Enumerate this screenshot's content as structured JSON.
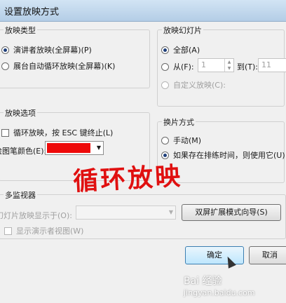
{
  "window": {
    "title": "设置放映方式"
  },
  "show_type": {
    "legend": "放映类型",
    "options": [
      {
        "label": "演讲者放映(全屏幕)(P)",
        "selected": true
      },
      {
        "label": "展台自动循环放映(全屏幕)(K)",
        "selected": false
      }
    ]
  },
  "show_slides": {
    "legend": "放映幻灯片",
    "all_label": "全部(A)",
    "from_label": "从(F):",
    "from_value": "1",
    "to_label": "到(T):",
    "to_value": "11",
    "custom_label": "自定义放映(C):"
  },
  "show_options": {
    "legend": "放映选项",
    "loop_label": "循环放映，按 ESC 键终止(L)",
    "pen_color_label": "绘图笔颜色(E):",
    "pen_color": "#ee0a0a"
  },
  "advance": {
    "legend": "换片方式",
    "manual_label": "手动(M)",
    "timing_label": "如果存在排练时间，则使用它(U)"
  },
  "monitors": {
    "legend": "多监视器",
    "display_label": "幻灯片放映显示于(O):",
    "wizard_button": "双屏扩展模式向导(S)",
    "presenter_label": "显示演示者视图(W)"
  },
  "buttons": {
    "ok": "确定",
    "cancel": "取消"
  },
  "overlay_text": "循环放映",
  "watermark": {
    "brand": "Bai 经验",
    "url": "jingyan.baidu.com"
  }
}
